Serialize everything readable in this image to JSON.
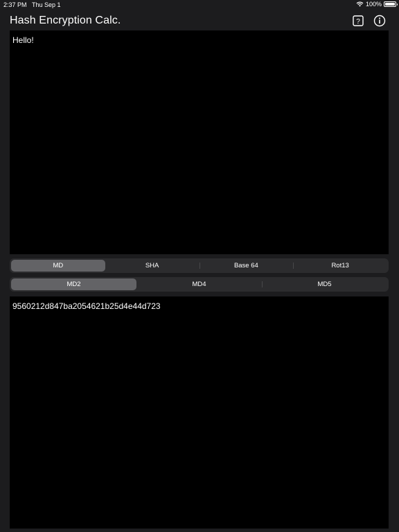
{
  "status_bar": {
    "time": "2:37 PM",
    "date": "Thu Sep 1",
    "battery": "100%",
    "battery_level": 1.0
  },
  "nav": {
    "title": "Hash Encryption Calc.",
    "help_icon": "help-question-icon",
    "info_icon": "info-icon"
  },
  "input": {
    "value": "Hello!"
  },
  "algorithm_family": {
    "options": [
      "MD",
      "SHA",
      "Base 64",
      "Rot13"
    ],
    "selected": "MD"
  },
  "algorithm_variant": {
    "options": [
      "MD2",
      "MD4",
      "MD5"
    ],
    "selected": "MD2"
  },
  "output": {
    "value": "9560212d847ba2054621b25d4e44d723"
  },
  "colors": {
    "background": "#1c1c1e",
    "text_area": "#000000",
    "segment_track": "#2c2c2e",
    "segment_selected": "#636366"
  }
}
